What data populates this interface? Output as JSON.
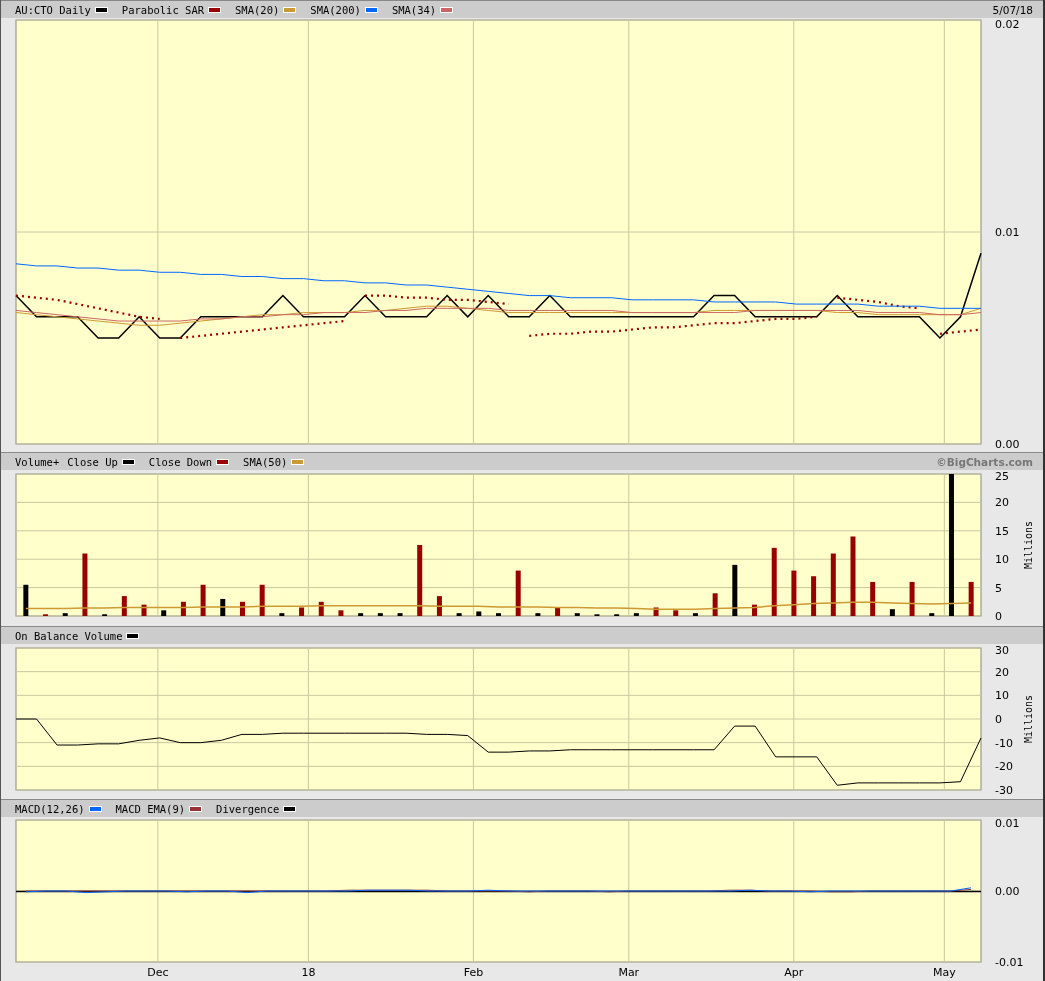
{
  "panels": [
    {
      "note": "5/07/18",
      "chart_data": {
        "type": "line",
        "ylim": [
          0,
          0.02
        ],
        "yticks": [
          {
            "value": 0,
            "label": "0.00"
          },
          {
            "value": 0.01,
            "label": "0.01"
          },
          {
            "value": 0.02,
            "label": "0.02"
          }
        ],
        "grid": true,
        "series": [
          {
            "name": "AU:CTO Daily",
            "color": "#000000",
            "values": [
              0.007,
              0.006,
              0.006,
              0.006,
              0.005,
              0.005,
              0.006,
              0.005,
              0.005,
              0.006,
              0.006,
              0.006,
              0.006,
              0.007,
              0.006,
              0.006,
              0.006,
              0.007,
              0.006,
              0.006,
              0.006,
              0.007,
              0.006,
              0.007,
              0.006,
              0.006,
              0.007,
              0.006,
              0.006,
              0.006,
              0.006,
              0.006,
              0.006,
              0.006,
              0.007,
              0.007,
              0.006,
              0.006,
              0.006,
              0.006,
              0.007,
              0.006,
              0.006,
              0.006,
              0.006,
              0.005,
              0.006,
              0.009
            ]
          },
          {
            "name": "Parabolic SAR",
            "color": "#990000",
            "line_style": "dotted",
            "values": [
              0.007,
              0.0069,
              0.0068,
              0.0066,
              0.0064,
              0.0062,
              0.006,
              0.0059,
              0.005,
              0.0051,
              0.0052,
              0.0053,
              0.0054,
              0.0055,
              0.0056,
              0.0057,
              0.0058,
              0.007,
              0.007,
              0.0069,
              0.0069,
              0.0068,
              0.0068,
              0.0067,
              0.0066,
              0.0051,
              0.0052,
              0.0052,
              0.0053,
              0.0053,
              0.0054,
              0.0055,
              0.0055,
              0.0056,
              0.0057,
              0.0057,
              0.0058,
              0.0059,
              0.0059,
              0.006,
              0.0069,
              0.0068,
              0.0067,
              0.0065,
              0.0064,
              0.0052,
              0.0053,
              0.0054
            ]
          },
          {
            "name": "SMA(20)",
            "color": "#cc9933",
            "values": [
              0.0062,
              0.0061,
              0.006,
              0.0059,
              0.0058,
              0.0057,
              0.0056,
              0.0056,
              0.0057,
              0.0058,
              0.0059,
              0.006,
              0.0061,
              0.0061,
              0.0062,
              0.0062,
              0.0062,
              0.0063,
              0.0063,
              0.0064,
              0.0065,
              0.0065,
              0.0064,
              0.0063,
              0.0062,
              0.0062,
              0.0062,
              0.0062,
              0.0062,
              0.0062,
              0.0062,
              0.0062,
              0.0062,
              0.0062,
              0.0063,
              0.0063,
              0.0063,
              0.0063,
              0.0063,
              0.0063,
              0.0062,
              0.0062,
              0.0061,
              0.0061,
              0.0061,
              0.0061,
              0.0061,
              0.0064
            ]
          },
          {
            "name": "SMA(200)",
            "color": "#0066ff",
            "values": [
              0.0085,
              0.0084,
              0.0084,
              0.0083,
              0.0083,
              0.0082,
              0.0082,
              0.0081,
              0.0081,
              0.008,
              0.008,
              0.0079,
              0.0079,
              0.0078,
              0.0078,
              0.0077,
              0.0077,
              0.0076,
              0.0076,
              0.0075,
              0.0075,
              0.0074,
              0.0073,
              0.0072,
              0.0071,
              0.007,
              0.007,
              0.0069,
              0.0069,
              0.0069,
              0.0068,
              0.0068,
              0.0068,
              0.0068,
              0.0067,
              0.0067,
              0.0067,
              0.0067,
              0.0066,
              0.0066,
              0.0066,
              0.0066,
              0.0065,
              0.0065,
              0.0065,
              0.0064,
              0.0064,
              0.0064
            ]
          },
          {
            "name": "SMA(34)",
            "color": "#cc6666",
            "values": [
              0.0063,
              0.0062,
              0.0061,
              0.006,
              0.0059,
              0.0058,
              0.0058,
              0.0058,
              0.0058,
              0.0059,
              0.0059,
              0.006,
              0.006,
              0.0061,
              0.0061,
              0.0062,
              0.0062,
              0.0062,
              0.0063,
              0.0063,
              0.0064,
              0.0064,
              0.0064,
              0.0064,
              0.0063,
              0.0063,
              0.0063,
              0.0063,
              0.0063,
              0.0063,
              0.0062,
              0.0062,
              0.0062,
              0.0062,
              0.0062,
              0.0062,
              0.0063,
              0.0063,
              0.0063,
              0.0063,
              0.0063,
              0.0063,
              0.0062,
              0.0062,
              0.0062,
              0.0061,
              0.0061,
              0.0062
            ]
          }
        ]
      }
    },
    {
      "note": "©BigCharts.com",
      "chart_data": {
        "type": "bar",
        "title": "Volume+",
        "ylabel": "Millions",
        "ylim": [
          0,
          25
        ],
        "yticks": [
          0,
          5,
          10,
          15,
          20,
          25
        ],
        "grid": true,
        "series": [
          {
            "name": "Close Up",
            "color": "#000000",
            "values": [
              5.5,
              null,
              0.5,
              null,
              0.3,
              null,
              null,
              1,
              null,
              null,
              3,
              null,
              null,
              0.5,
              null,
              null,
              null,
              0.5,
              0.5,
              0.5,
              null,
              null,
              0.5,
              0.8,
              0.5,
              null,
              0.5,
              null,
              0.5,
              0.3,
              0.3,
              0.5,
              null,
              null,
              0.5,
              null,
              9,
              null,
              null,
              null,
              null,
              null,
              null,
              null,
              1.2,
              null,
              0.5,
              25,
              null
            ]
          },
          {
            "name": "Close Down",
            "color": "#990000",
            "values": [
              null,
              0.3,
              null,
              11,
              null,
              3.5,
              2,
              null,
              2.5,
              5.5,
              null,
              2.5,
              5.5,
              null,
              1.5,
              2.5,
              1,
              null,
              null,
              null,
              12.5,
              3.5,
              null,
              null,
              null,
              8,
              null,
              1.5,
              null,
              null,
              null,
              null,
              1.5,
              1,
              null,
              4,
              null,
              2,
              12,
              8,
              7,
              11,
              14,
              6,
              null,
              6,
              null,
              null,
              6
            ]
          },
          {
            "name": "SMA(50)",
            "color": "#cc9933",
            "type": "line",
            "values": [
              1.3,
              1.3,
              1.3,
              1.4,
              1.4,
              1.5,
              1.5,
              1.5,
              1.5,
              1.6,
              1.6,
              1.6,
              1.7,
              1.7,
              1.7,
              1.8,
              1.8,
              1.8,
              1.8,
              1.8,
              1.8,
              1.7,
              1.7,
              1.7,
              1.6,
              1.6,
              1.6,
              1.5,
              1.5,
              1.4,
              1.4,
              1.3,
              1.2,
              1.2,
              1.2,
              1.3,
              1.4,
              1.5,
              1.8,
              2,
              2.2,
              2.3,
              2.4,
              2.4,
              2.3,
              2.2,
              2.1,
              2.2,
              2.3
            ]
          }
        ]
      }
    },
    {
      "chart_data": {
        "type": "line",
        "ylabel": "Millions",
        "ylim": [
          -30,
          30
        ],
        "yticks": [
          -30,
          -20,
          -10,
          0,
          10,
          20,
          30
        ],
        "grid": true,
        "series": [
          {
            "name": "On Balance Volume",
            "color": "#000000",
            "values": [
              0,
              0,
              -11,
              -11,
              -10.5,
              -10.5,
              -9,
              -8,
              -10,
              -10,
              -9,
              -6.5,
              -6.5,
              -6,
              -6,
              -6,
              -6,
              -6,
              -6,
              -6,
              -6.5,
              -6.5,
              -7,
              -14,
              -14,
              -13.5,
              -13.5,
              -13,
              -13,
              -13,
              -13,
              -13,
              -13,
              -13,
              -13,
              -3,
              -3,
              -16,
              -16,
              -16,
              -28,
              -27,
              -27,
              -27,
              -27,
              -27,
              -26.5,
              -8
            ]
          }
        ]
      }
    },
    {
      "legend": [
        {
          "label": "MACD(12,26)",
          "color": "#0066ff"
        },
        {
          "label": "MACD EMA(9)",
          "color": "#993333"
        },
        {
          "label": "Divergence",
          "color": "#000000"
        }
      ],
      "axis_ticks": [
        "0.01",
        "0.00",
        "-0.01"
      ],
      "x_labels": [
        "Dec",
        "18",
        "Feb",
        "Mar",
        "Apr",
        "May"
      ]
    }
  ]
}
